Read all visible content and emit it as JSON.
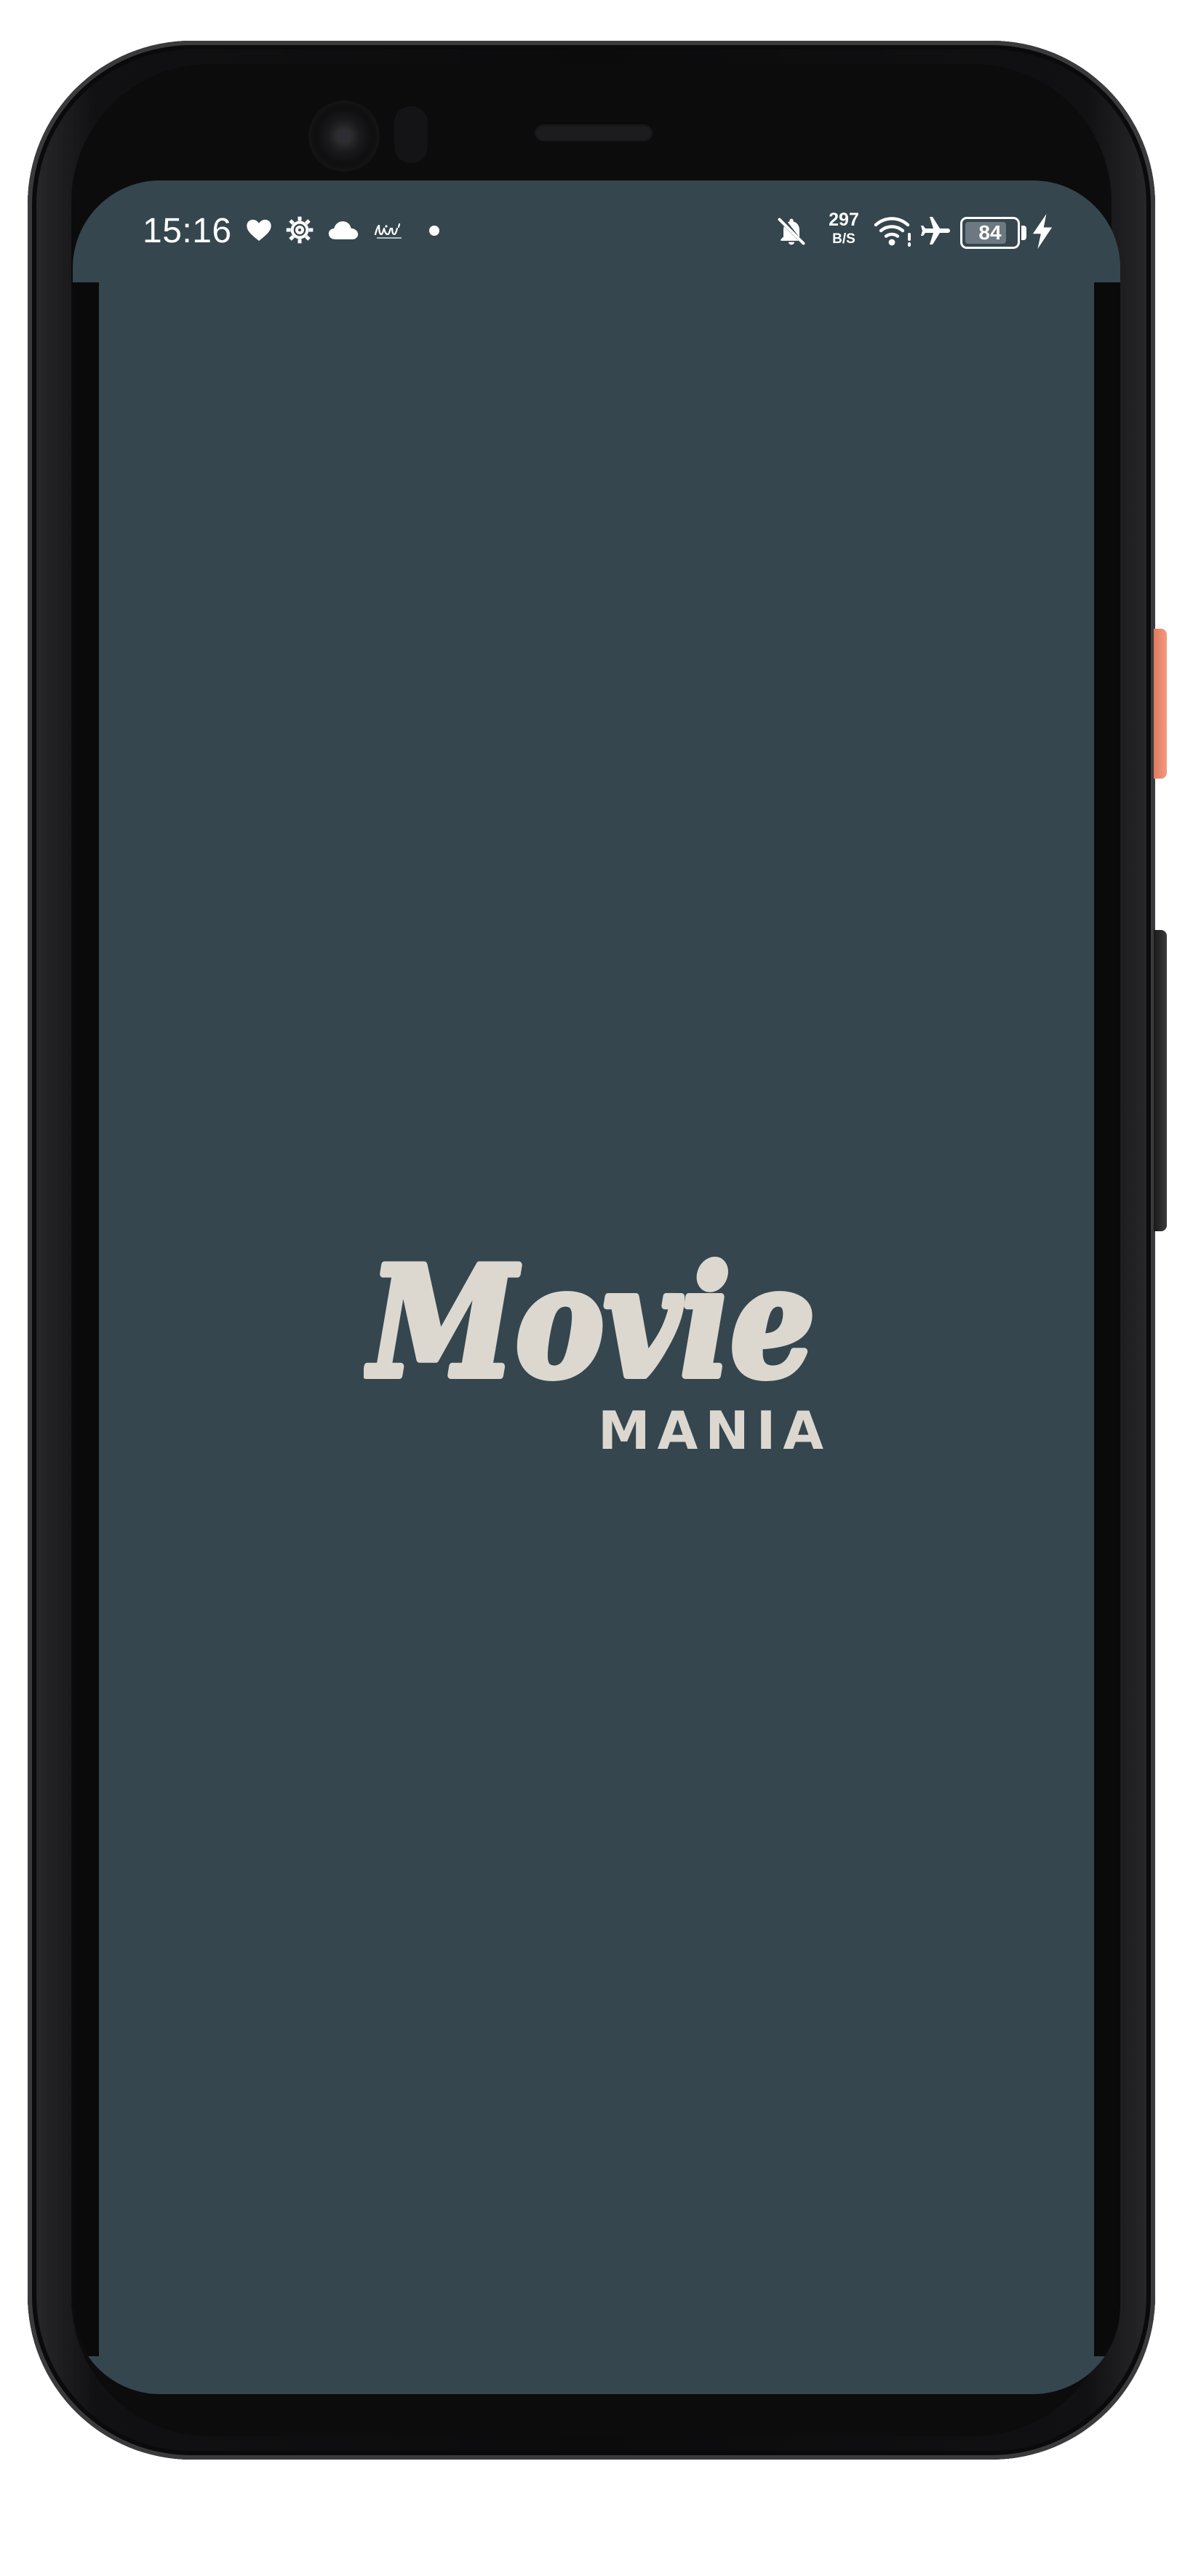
{
  "status_bar": {
    "time": "15:16",
    "left_icons": [
      "heart-icon",
      "settings-gear-icon",
      "cloud-icon",
      "app-notification-icon",
      "dot-icon"
    ],
    "net_speed_value": "297",
    "net_speed_unit": "B/S",
    "right_icons": [
      "bell-off-icon",
      "wifi-icon",
      "airplane-mode-icon",
      "charging-bolt-icon"
    ],
    "battery_level": "84",
    "battery_fraction": 0.84
  },
  "splash": {
    "logo_script": "Movie",
    "logo_subtitle": "MANIA",
    "logo_color": "#dcd8d0",
    "background_color": "#35464f"
  }
}
